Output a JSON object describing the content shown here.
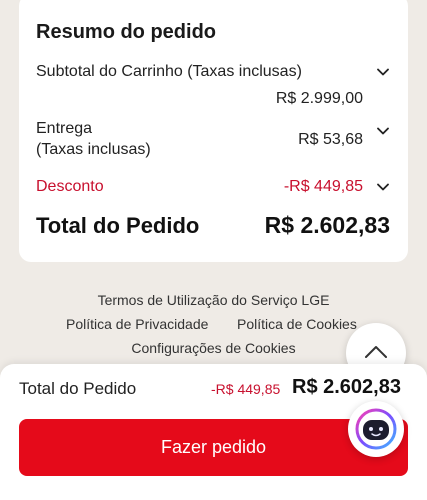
{
  "summary": {
    "title": "Resumo do pedido",
    "subtotal": {
      "label": "Subtotal do Carrinho (Taxas inclusas)",
      "value": "R$ 2.999,00"
    },
    "delivery": {
      "label_line1": "Entrega",
      "label_line2": "(Taxas inclusas)",
      "value": "R$ 53,68"
    },
    "discount": {
      "label": "Desconto",
      "value": "-R$ 449,85"
    },
    "total": {
      "label": "Total do Pedido",
      "value": "R$ 2.602,83"
    }
  },
  "footer": {
    "terms": "Termos de Utilização do Serviço LGE",
    "privacy": "Política de Privacidade",
    "cookies_policy": "Política de Cookies",
    "cookie_settings": "Configurações de Cookies"
  },
  "bottom_bar": {
    "total_label": "Total do Pedido",
    "discount": "-R$ 449,85",
    "total_value": "R$ 2.602,83",
    "order_button": "Fazer pedido"
  },
  "icons": {
    "expand": "chevron-down-icon",
    "scroll_top": "chevron-up-icon",
    "chat": "chatbot-icon"
  },
  "colors": {
    "accent": "#e50a1a",
    "discount": "#c8102e",
    "background": "#efebe6"
  }
}
